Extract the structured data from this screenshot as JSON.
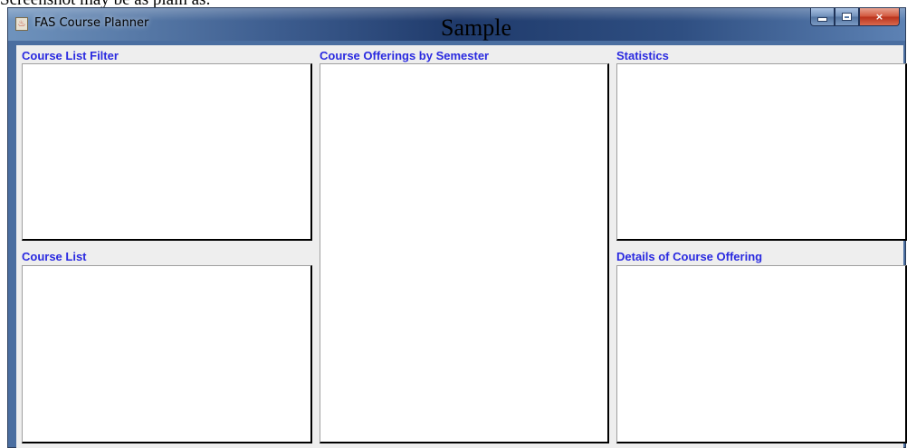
{
  "caption": "Screenshot may be as plain as:",
  "window": {
    "title": "FAS Course Planner",
    "watermark": "Sample",
    "controls": {
      "minimize": "minimize",
      "maximize": "maximize",
      "close": "×"
    },
    "icon": "java-coffee-icon"
  },
  "panels": {
    "course_list_filter": "Course List Filter",
    "course_list": "Course List",
    "course_offerings": "Course Offerings by Semester",
    "statistics": "Statistics",
    "details": "Details of Course Offering"
  },
  "colors": {
    "label_blue": "#2a2ae0",
    "client_bg": "#eeeeee",
    "close_red": "#c84a30"
  }
}
